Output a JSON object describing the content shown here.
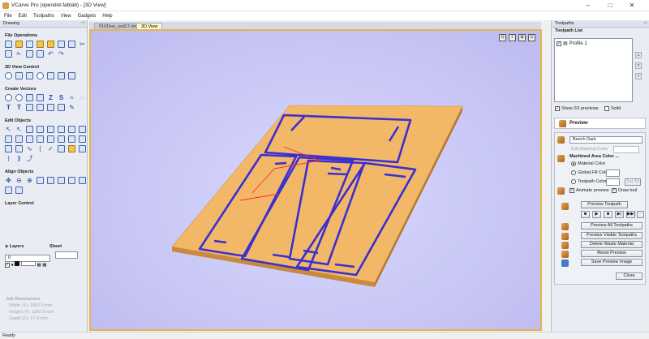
{
  "window": {
    "title": "VCarve Pro (opendot-fablab) - [3D View]",
    "min": "–",
    "max": "□",
    "close": "✕"
  },
  "menu": [
    "File",
    "Edit",
    "Toolpaths",
    "View",
    "Gadgets",
    "Help"
  ],
  "left_panel": {
    "header": "Drawing",
    "sections": {
      "file_ops": "File Operations",
      "view2d": "2D View Control",
      "create_vectors": "Create Vectors",
      "edit_objects": "Edit Objects",
      "align_objects": "Align Objects",
      "layer_control": "Layer Control"
    },
    "layers_label": "Layers",
    "sheet_label": "Sheet",
    "layer_value": "0",
    "job_dims": {
      "header": "Job Dimensions",
      "width": "Width  (X): 1850.0 mm",
      "height": "Height (Y): 1250.0 mm",
      "depth": "Depth  (Z): 17.0 mm"
    }
  },
  "doc_tabs": [
    "0161bar_ssd17.dxf",
    "3D View"
  ],
  "viewport": {
    "buttons": [
      "⊡",
      "⇩",
      "⊠",
      "⊡"
    ],
    "material_color": "#f2b868",
    "toolpath_color": "#3a2fd0"
  },
  "right_panel": {
    "header": "Toolpaths",
    "list_header": "Toolpath List",
    "items": [
      {
        "label": "Profile 1",
        "checked": true
      }
    ],
    "show_2d": "Show 2D previews",
    "solid": "Solid",
    "preview_title": "Preview",
    "material": "Beech Dark",
    "edit_material": "Edit Material Color",
    "machined_area": "Machined Area Color ...",
    "material_color": "Material Color",
    "global_fill": "Global Fill Color",
    "toolpath_color": "Toolpath Color",
    "set_all": "Set All",
    "animate": "Animate preview",
    "draw_tool": "Draw tool",
    "preview_toolpath": "Preview Toolpath",
    "preview_all": "Preview All Toolpaths",
    "preview_visible": "Preview Visible Toolpaths",
    "delete_waste": "Delete Waste Material",
    "reset_preview": "Reset Preview",
    "save_preview": "Save Preview Image",
    "close": "Close",
    "transport": [
      "■",
      "▶",
      "■",
      "▶|",
      "▶▶|",
      "⋯"
    ]
  },
  "status": "Ready"
}
